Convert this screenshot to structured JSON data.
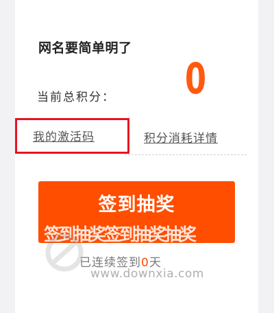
{
  "user": {
    "name": "网名要简单明了"
  },
  "points": {
    "label": "当前总积分：",
    "value": "0"
  },
  "links": {
    "activation_code": "我的激活码",
    "points_details": "积分消耗详情"
  },
  "signin": {
    "button_label": "签到抽奖",
    "ghost_text": "签到抽奖签到抽奖抽奖",
    "streak_prefix": "已连续签到",
    "streak_days": "0",
    "streak_suffix": "天"
  },
  "watermark": {
    "text": "www.downxia.com"
  },
  "colors": {
    "accent": "#ff4e00",
    "highlight_box": "#e81123"
  }
}
